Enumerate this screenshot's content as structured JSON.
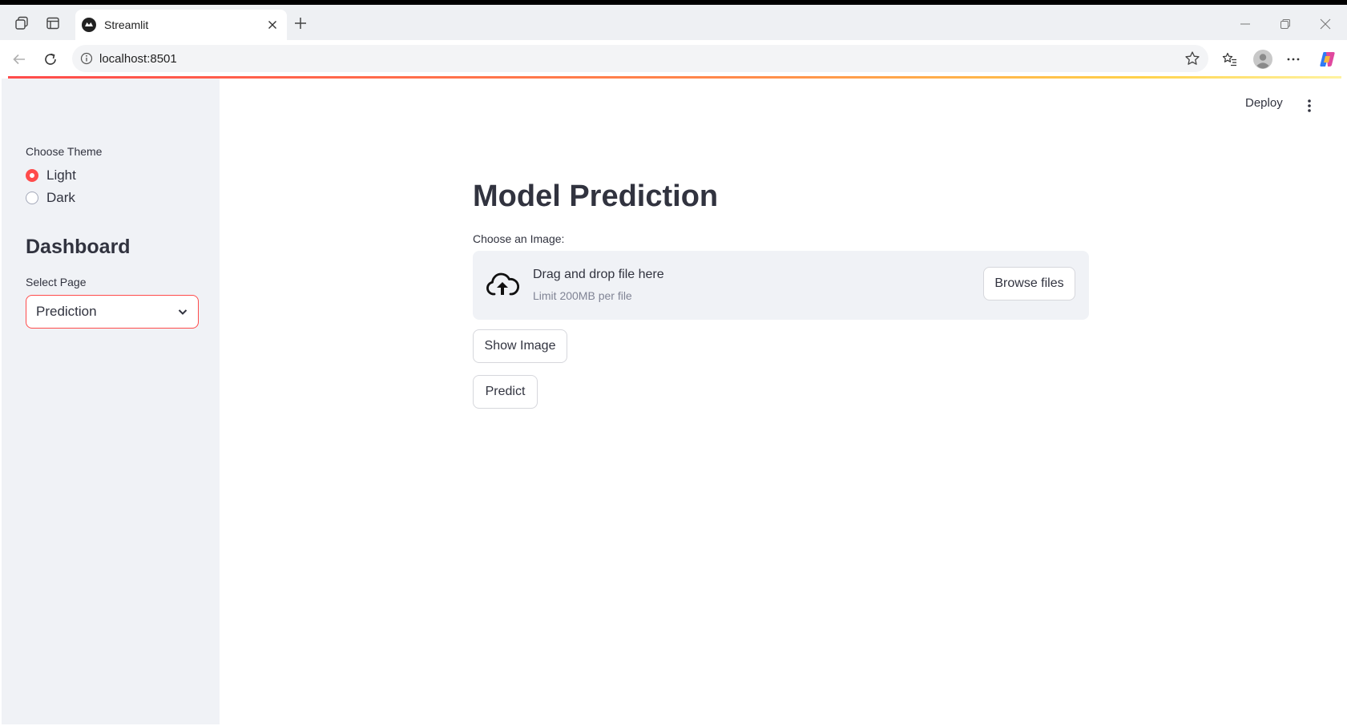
{
  "browser": {
    "tab_title": "Streamlit",
    "url": "localhost:8501"
  },
  "sidebar": {
    "theme_label": "Choose Theme",
    "theme_options": [
      {
        "label": "Light",
        "selected": true
      },
      {
        "label": "Dark",
        "selected": false
      }
    ],
    "heading": "Dashboard",
    "select_label": "Select Page",
    "select_value": "Prediction"
  },
  "header": {
    "deploy_label": "Deploy"
  },
  "main": {
    "title": "Model Prediction",
    "uploader": {
      "label": "Choose an Image:",
      "drop_text": "Drag and drop file here",
      "limit_text": "Limit 200MB per file",
      "browse_label": "Browse files"
    },
    "show_image_label": "Show Image",
    "predict_label": "Predict"
  },
  "colors": {
    "accent": "#ff4b4b",
    "sidebar_bg": "#f0f2f6",
    "text": "#31333f"
  }
}
